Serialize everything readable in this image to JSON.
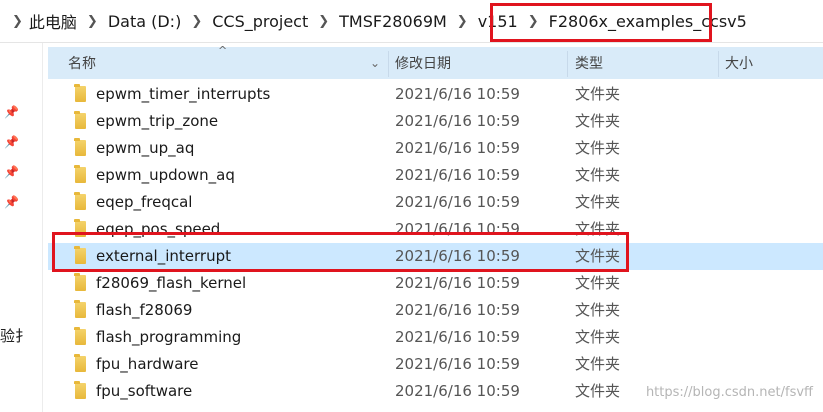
{
  "breadcrumb": [
    "此电脑",
    "Data (D:)",
    "CCS_project",
    "TMSF28069M",
    "v151",
    "F2806x_examples_ccsv5"
  ],
  "columns": {
    "name": "名称",
    "date": "修改日期",
    "type": "类型",
    "size": "大小"
  },
  "nav_pane_text": "验扌",
  "rows": [
    {
      "name": "epwm_timer_interrupts",
      "date": "2021/6/16 10:59",
      "type": "文件夹"
    },
    {
      "name": "epwm_trip_zone",
      "date": "2021/6/16 10:59",
      "type": "文件夹"
    },
    {
      "name": "epwm_up_aq",
      "date": "2021/6/16 10:59",
      "type": "文件夹"
    },
    {
      "name": "epwm_updown_aq",
      "date": "2021/6/16 10:59",
      "type": "文件夹"
    },
    {
      "name": "eqep_freqcal",
      "date": "2021/6/16 10:59",
      "type": "文件夹"
    },
    {
      "name": "eqep_pos_speed",
      "date": "2021/6/16 10:59",
      "type": "文件夹"
    },
    {
      "name": "external_interrupt",
      "date": "2021/6/16 10:59",
      "type": "文件夹",
      "selected": true
    },
    {
      "name": "f28069_flash_kernel",
      "date": "2021/6/16 10:59",
      "type": "文件夹"
    },
    {
      "name": "flash_f28069",
      "date": "2021/6/16 10:59",
      "type": "文件夹"
    },
    {
      "name": "flash_programming",
      "date": "2021/6/16 10:59",
      "type": "文件夹"
    },
    {
      "name": "fpu_hardware",
      "date": "2021/6/16 10:59",
      "type": "文件夹"
    },
    {
      "name": "fpu_software",
      "date": "2021/6/16 10:59",
      "type": "文件夹"
    }
  ],
  "watermark": "https://blog.csdn.net/fsvff",
  "colors": {
    "header_bg": "#d9ebf9",
    "selected_bg": "#cce8ff",
    "highlight": "#e0141e",
    "folder": "#e8b83a"
  }
}
